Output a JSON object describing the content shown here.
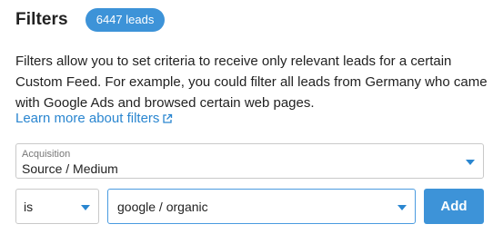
{
  "header": {
    "title": "Filters",
    "leads_badge": "6447 leads"
  },
  "description": "Filters allow you to set criteria to receive only relevant leads for a certain Custom Feed. For example, you could filter all leads from Germany who came with Google Ads and browsed certain web pages.",
  "learn_more": {
    "label": "Learn more about filters",
    "icon": "external-link-icon"
  },
  "acquisition_select": {
    "label": "Acquisition",
    "value": "Source / Medium"
  },
  "operator_select": {
    "value": "is"
  },
  "value_select": {
    "value": "google / organic"
  },
  "add_button": {
    "label": "Add"
  },
  "colors": {
    "accent": "#3d93d8",
    "link": "#2a86d0",
    "border": "#c9c9c9",
    "focus_border": "#4a9be0"
  }
}
